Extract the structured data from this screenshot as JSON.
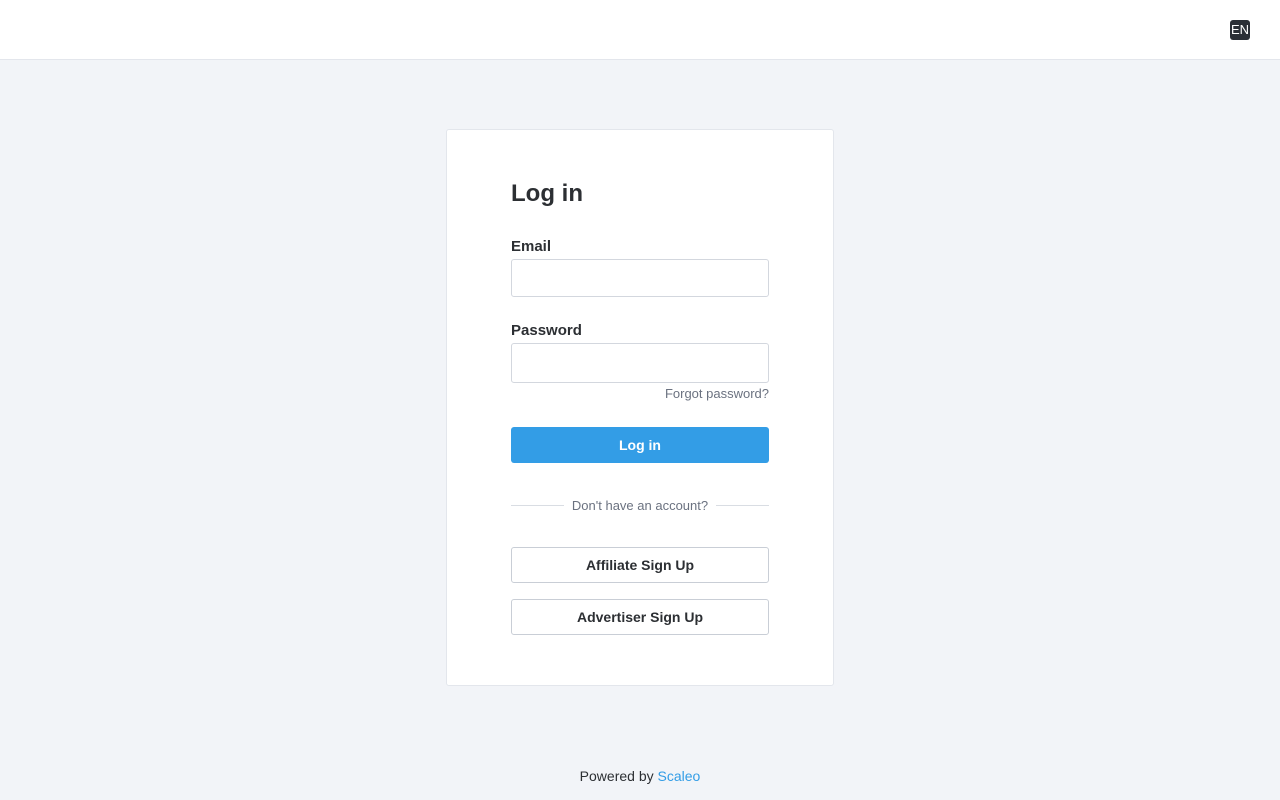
{
  "header": {
    "language": "EN"
  },
  "login_form": {
    "title": "Log in",
    "email_label": "Email",
    "email_value": "",
    "password_label": "Password",
    "password_value": "",
    "forgot_password": "Forgot password?",
    "submit_label": "Log in",
    "divider_text": "Don't have an account?",
    "affiliate_signup_label": "Affiliate Sign Up",
    "advertiser_signup_label": "Advertiser Sign Up"
  },
  "footer": {
    "powered_by": "Powered by",
    "brand_link": "Scaleo"
  },
  "colors": {
    "accent": "#339de6",
    "background": "#f2f4f8",
    "language_badge": "#2b2f36"
  }
}
